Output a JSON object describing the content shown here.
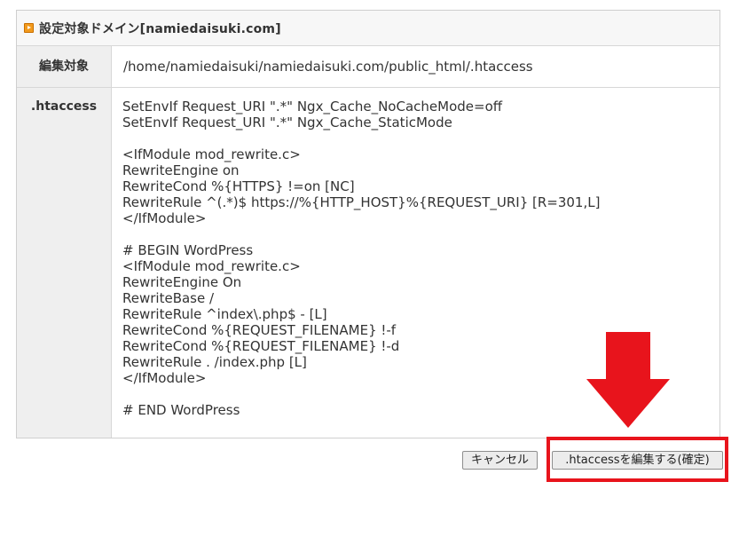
{
  "panel": {
    "title": "設定対象ドメイン[namiedaisuki.com]",
    "rows": {
      "target_label": "編集対象",
      "target_value": "/home/namiedaisuki/namiedaisuki.com/public_html/.htaccess",
      "htaccess_label": ".htaccess",
      "htaccess_content": "SetEnvIf Request_URI \".*\" Ngx_Cache_NoCacheMode=off\nSetEnvIf Request_URI \".*\" Ngx_Cache_StaticMode\n\n<IfModule mod_rewrite.c>\nRewriteEngine on\nRewriteCond %{HTTPS} !=on [NC]\nRewriteRule ^(.*)$ https://%{HTTP_HOST}%{REQUEST_URI} [R=301,L]\n</IfModule>\n\n# BEGIN WordPress\n<IfModule mod_rewrite.c>\nRewriteEngine On\nRewriteBase /\nRewriteRule ^index\\.php$ - [L]\nRewriteCond %{REQUEST_FILENAME} !-f\nRewriteCond %{REQUEST_FILENAME} !-d\nRewriteRule . /index.php [L]\n</IfModule>\n\n# END WordPress"
    }
  },
  "buttons": {
    "cancel": "キャンセル",
    "confirm": ".htaccessを編集する(確定)"
  },
  "colors": {
    "annotation_red": "#e8141c",
    "header_icon": "#f29a1d"
  }
}
